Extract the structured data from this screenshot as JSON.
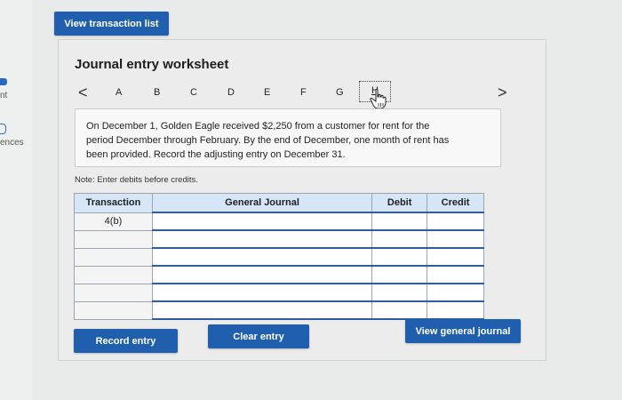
{
  "left_nav": {
    "items": [
      {
        "label": "nt"
      },
      {
        "label": "ences"
      }
    ]
  },
  "header": {
    "view_transaction_list": "View transaction list"
  },
  "worksheet": {
    "title": "Journal entry worksheet",
    "prev_arrow": "<",
    "next_arrow": ">",
    "tabs": [
      "A",
      "B",
      "C",
      "D",
      "E",
      "F",
      "G",
      "H"
    ],
    "active_tab": "H",
    "problem_text": "On December 1, Golden Eagle received $2,250 from a customer for rent for the period December through February. By the end of December, one month of rent has been provided. Record the adjusting entry on December 31.",
    "note": "Note: Enter debits before credits.",
    "table": {
      "headers": {
        "transaction": "Transaction",
        "general_journal": "General Journal",
        "debit": "Debit",
        "credit": "Credit"
      },
      "rows": [
        {
          "transaction": "4(b)",
          "account": "",
          "debit": "",
          "credit": ""
        },
        {
          "transaction": "",
          "account": "",
          "debit": "",
          "credit": ""
        },
        {
          "transaction": "",
          "account": "",
          "debit": "",
          "credit": ""
        },
        {
          "transaction": "",
          "account": "",
          "debit": "",
          "credit": ""
        },
        {
          "transaction": "",
          "account": "",
          "debit": "",
          "credit": ""
        },
        {
          "transaction": "",
          "account": "",
          "debit": "",
          "credit": ""
        }
      ]
    },
    "buttons": {
      "record_entry": "Record entry",
      "clear_entry": "Clear entry",
      "view_general_journal": "View general journal"
    }
  },
  "colors": {
    "primary_button": "#1f5fae",
    "table_header": "#d6e6f7",
    "input_border": "#2d5da0"
  }
}
